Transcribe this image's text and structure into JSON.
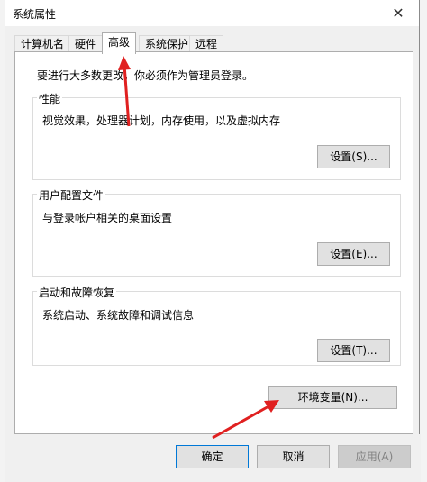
{
  "window": {
    "title": "系统属性",
    "close_icon": "close-icon"
  },
  "tabs": [
    {
      "label": "计算机名"
    },
    {
      "label": "硬件"
    },
    {
      "label": "高级"
    },
    {
      "label": "系统保护"
    },
    {
      "label": "远程"
    }
  ],
  "advanced": {
    "intro": "要进行大多数更改，你必须作为管理员登录。",
    "performance": {
      "title": "性能",
      "desc": "视觉效果，处理器计划，内存使用，以及虚拟内存",
      "button": "设置(S)..."
    },
    "profiles": {
      "title": "用户配置文件",
      "desc": "与登录帐户相关的桌面设置",
      "button": "设置(E)..."
    },
    "startup": {
      "title": "启动和故障恢复",
      "desc": "系统启动、系统故障和调试信息",
      "button": "设置(T)..."
    },
    "env_button": "环境变量(N)..."
  },
  "footer": {
    "ok": "确定",
    "cancel": "取消",
    "apply": "应用(A)"
  },
  "annotation_color": "#e02020"
}
